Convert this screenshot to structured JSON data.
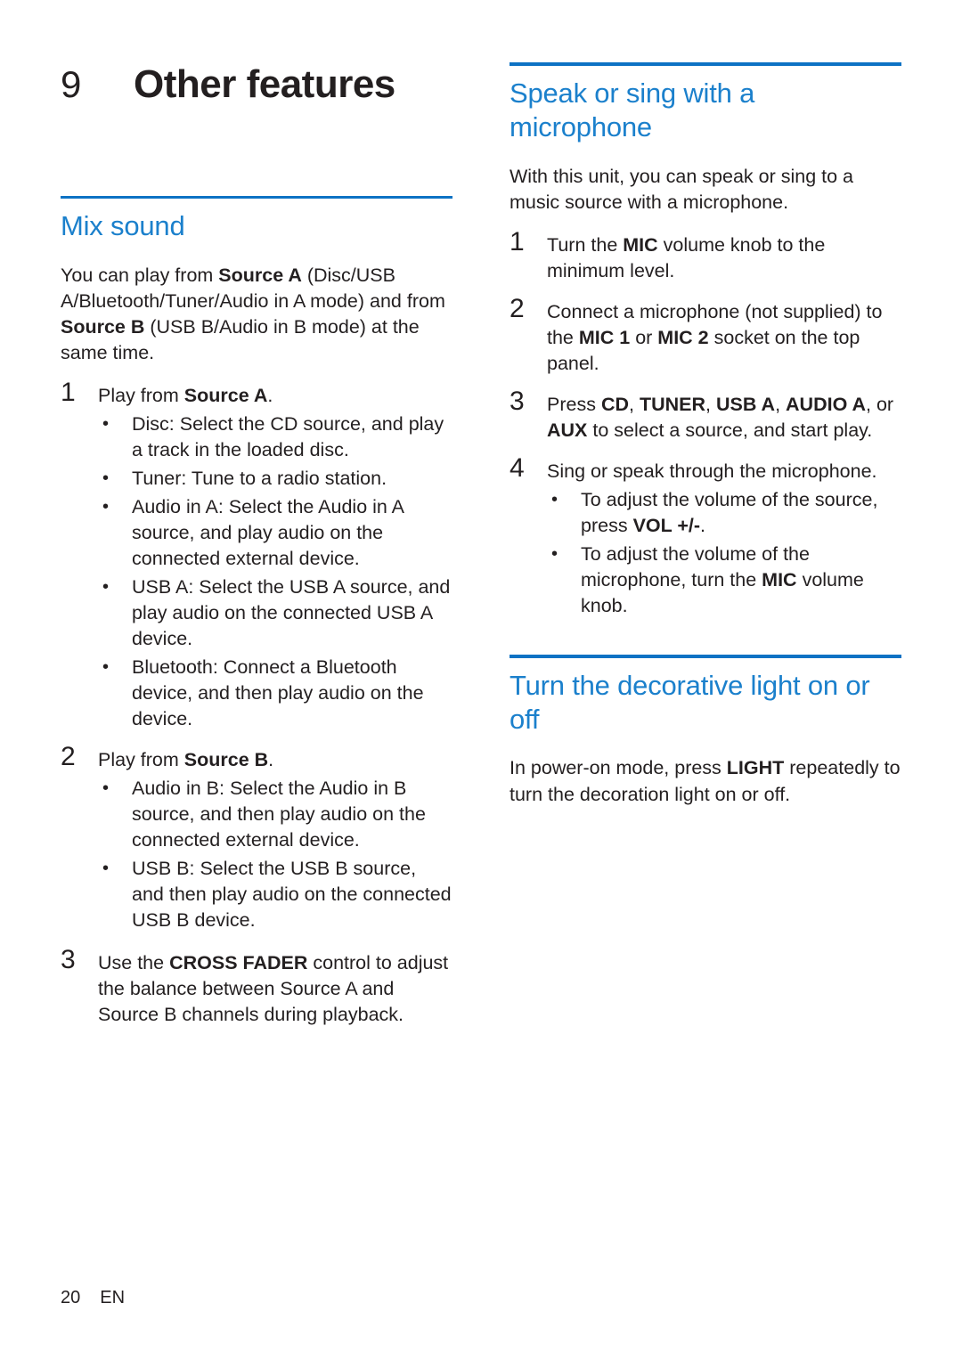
{
  "page": {
    "number": "20",
    "language": "EN"
  },
  "chapter": {
    "number": "9",
    "title": "Other features"
  },
  "left_column": {
    "section1": {
      "heading": "Mix sound",
      "intro_parts": [
        {
          "t": "You can play from ",
          "b": false
        },
        {
          "t": "Source A",
          "b": true
        },
        {
          "t": " (Disc/USB A/Bluetooth/Tuner/Audio in A mode) and from ",
          "b": false
        },
        {
          "t": "Source B",
          "b": true
        },
        {
          "t": " (USB B/Audio in B mode) at the same time.",
          "b": false
        }
      ],
      "intro_text": "You can play from Source A (Disc/USB A/Bluetooth/Tuner/Audio in A mode) and from Source B (USB B/Audio in B mode) at the same time.",
      "steps": [
        {
          "num": "1",
          "text": "Play from Source A.",
          "bullets": [
            "Disc: Select the CD source, and play a track in the loaded disc.",
            "Tuner: Tune to a radio station.",
            "Audio in A: Select the Audio in A source, and play audio on the connected external device.",
            "USB A: Select the USB A source, and play audio on the connected USB A device.",
            "Bluetooth: Connect a Bluetooth device, and then play audio on the device."
          ]
        },
        {
          "num": "2",
          "text": "Play from Source B.",
          "bullets": [
            "Audio in B: Select the Audio in B source, and then play audio on the connected external device.",
            "USB B: Select the USB B source, and then play audio on the connected USB B device."
          ]
        },
        {
          "num": "3",
          "text": "Use the CROSS FADER control to adjust the balance between Source A and Source B channels during playback.",
          "bullets": []
        }
      ]
    }
  },
  "right_column": {
    "section1": {
      "heading": "Speak or sing with a microphone",
      "intro_text": "With this unit, you can speak or sing to a music source with a microphone.",
      "steps": [
        {
          "num": "1",
          "text": "Turn the MIC volume knob to the minimum level.",
          "bullets": []
        },
        {
          "num": "2",
          "text": "Connect a microphone (not supplied) to the MIC 1 or MIC 2 socket on the top panel.",
          "bullets": []
        },
        {
          "num": "3",
          "text": "Press CD, TUNER, USB A, AUDIO A, or AUX to select a source, and start play.",
          "bullets": []
        },
        {
          "num": "4",
          "text": "Sing or speak through the microphone.",
          "bullets": [
            "To adjust the volume of the source, press VOL +/-.",
            "To adjust the volume of the microphone, turn the MIC volume knob."
          ]
        }
      ]
    },
    "section2": {
      "heading": "Turn the decorative light on or off",
      "body_text": "In power-on mode, press LIGHT repeatedly to turn the decoration light on or off."
    }
  }
}
